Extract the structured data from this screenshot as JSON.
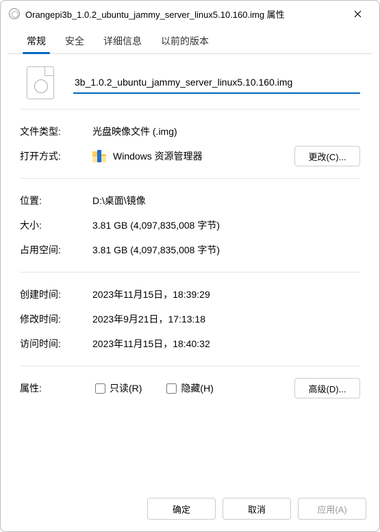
{
  "window": {
    "title": "Orangepi3b_1.0.2_ubuntu_jammy_server_linux5.10.160.img 属性"
  },
  "tabs": {
    "general": "常规",
    "security": "安全",
    "details": "详细信息",
    "previous": "以前的版本"
  },
  "filename": "3b_1.0.2_ubuntu_jammy_server_linux5.10.160.img",
  "labels": {
    "filetype": "文件类型:",
    "openwith": "打开方式:",
    "location": "位置:",
    "size": "大小:",
    "sizeondisk": "占用空间:",
    "created": "创建时间:",
    "modified": "修改时间:",
    "accessed": "访问时间:",
    "attributes": "属性:",
    "readonly": "只读(R)",
    "hidden": "隐藏(H)"
  },
  "values": {
    "filetype": "光盘映像文件 (.img)",
    "openwith": "Windows 资源管理器",
    "location": "D:\\桌面\\镜像",
    "size": "3.81 GB (4,097,835,008 字节)",
    "sizeondisk": "3.81 GB (4,097,835,008 字节)",
    "created": "2023年11月15日，18:39:29",
    "modified": "2023年9月21日，17:13:18",
    "accessed": "2023年11月15日，18:40:32"
  },
  "buttons": {
    "change": "更改(C)...",
    "advanced": "高级(D)...",
    "ok": "确定",
    "cancel": "取消",
    "apply": "应用(A)"
  }
}
